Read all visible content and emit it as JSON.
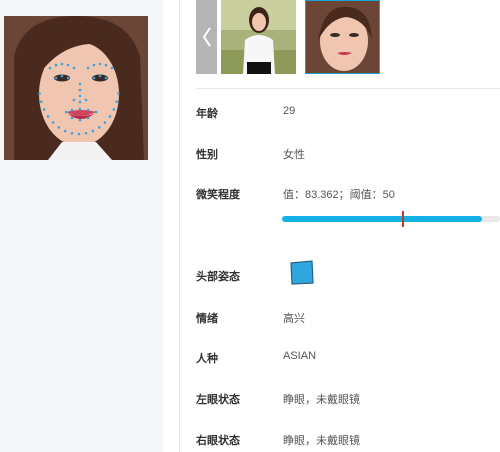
{
  "detail": {
    "rows": [
      {
        "label": "年龄",
        "value": "29"
      },
      {
        "label": "性别",
        "value": "女性"
      },
      {
        "label": "微笑程度",
        "value": "值：83.362；阈值：50"
      },
      {
        "label": "头部姿态"
      },
      {
        "label": "情绪",
        "value": "高兴"
      },
      {
        "label": "人种",
        "value": "ASIAN"
      },
      {
        "label": "左眼状态",
        "value": "睁眼，未戴眼镜"
      },
      {
        "label": "右眼状态",
        "value": "睁眼，未戴眼镜"
      }
    ],
    "smile": {
      "value": 83.362,
      "threshold": 50,
      "max": 100
    }
  },
  "colors": {
    "accent": "#14b2e4",
    "threshold_marker": "#c0392b",
    "landmark": "#3aa0e0"
  },
  "icons": {
    "prev": "chevron-left-icon",
    "pose": "head-pose-cube-icon"
  }
}
